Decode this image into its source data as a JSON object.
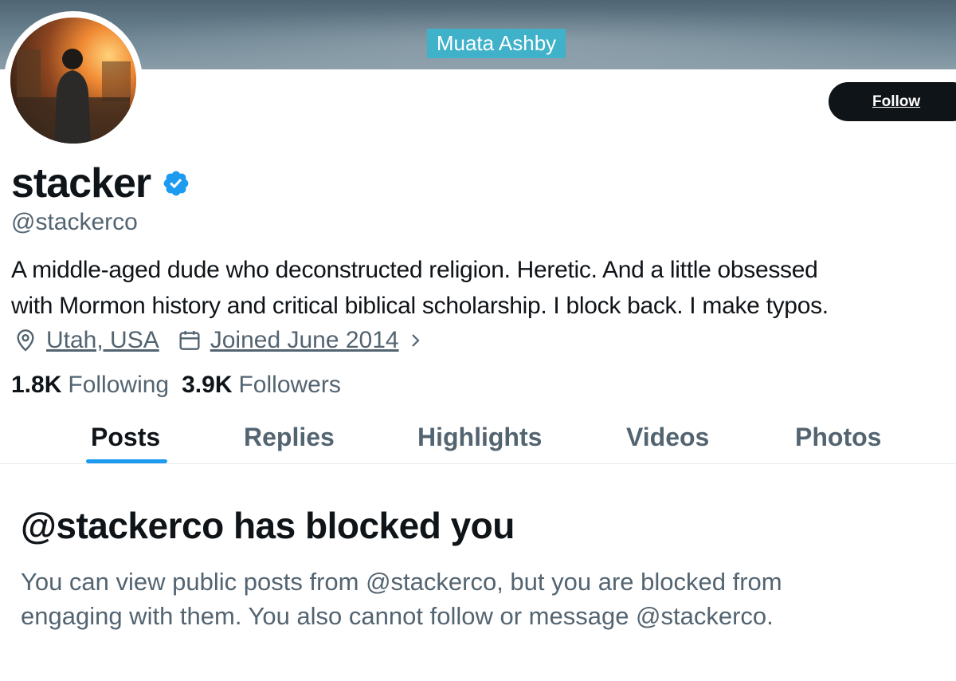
{
  "banner": {
    "caption": "Muata Ashby"
  },
  "profile": {
    "display_name": "stacker",
    "handle": "@stackerco",
    "bio_line1": "A middle-aged dude who deconstructed religion. Heretic. And a little obsessed",
    "bio_line2": "with Mormon history and critical biblical scholarship. I block back. I make typos.",
    "location": "Utah, USA",
    "joined": "Joined June 2014",
    "following_count": "1.8K",
    "following_label": "Following",
    "followers_count": "3.9K",
    "followers_label": "Followers"
  },
  "actions": {
    "follow_label": "Follow"
  },
  "tabs": [
    {
      "label": "Posts",
      "active": true
    },
    {
      "label": "Replies",
      "active": false
    },
    {
      "label": "Highlights",
      "active": false
    },
    {
      "label": "Videos",
      "active": false
    },
    {
      "label": "Photos",
      "active": false
    }
  ],
  "blocked": {
    "title": "@stackerco has blocked you",
    "line1": "You can view public posts from @stackerco, but you are blocked from",
    "line2": "engaging with them. You also cannot follow or message @stackerco."
  },
  "colors": {
    "accent": "#1d9bf0",
    "text": "#0f1419",
    "muted": "#536471"
  },
  "icons": [
    "verified-badge-icon",
    "location-pin-icon",
    "calendar-icon",
    "chevron-right-icon"
  ]
}
